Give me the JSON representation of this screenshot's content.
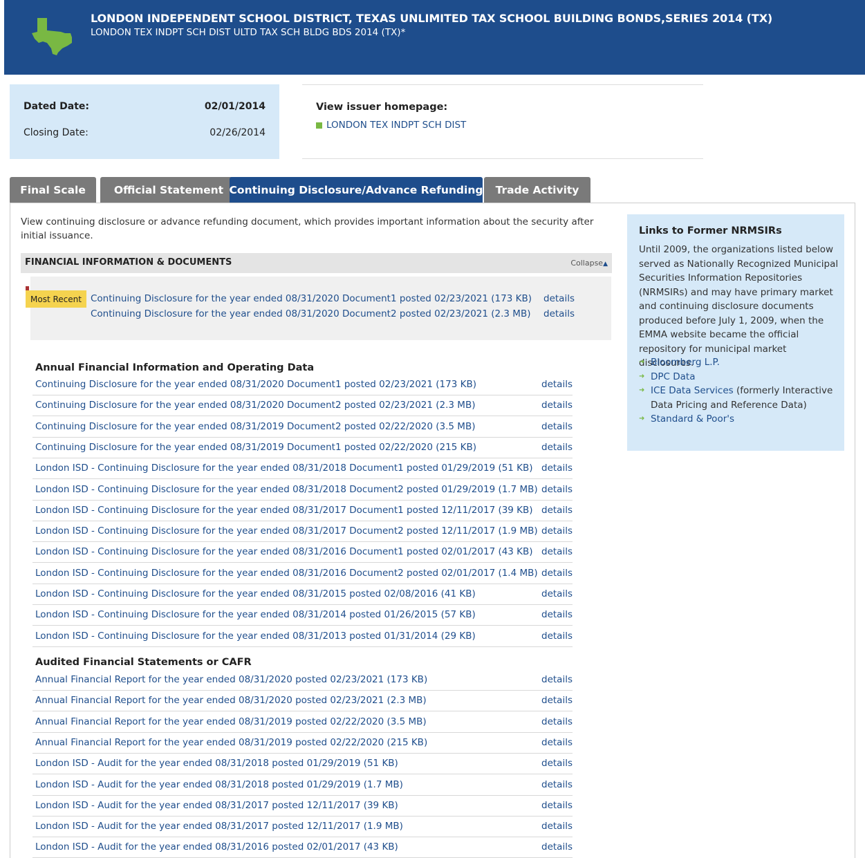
{
  "header": {
    "title": "LONDON INDEPENDENT SCHOOL DISTRICT, TEXAS UNLIMITED TAX SCHOOL BUILDING BONDS,SERIES 2014 (TX)",
    "subtitle": "LONDON TEX INDPT SCH DIST ULTD TAX SCH BLDG BDS 2014 (TX)*",
    "logo_icon": "texas-state-icon",
    "logo_color": "#79b843",
    "background": "#1e4d8c"
  },
  "dates": {
    "dated_label": "Dated Date:",
    "dated_value": "02/01/2014",
    "closing_label": "Closing Date:",
    "closing_value": "02/26/2014"
  },
  "issuer": {
    "label": "View issuer homepage:",
    "link": "LONDON TEX INDPT SCH DIST"
  },
  "tabs": [
    {
      "label": "Final Scale",
      "active": false
    },
    {
      "label": "Official Statement",
      "active": false
    },
    {
      "label": "Continuing Disclosure/Advance Refunding",
      "active": true
    },
    {
      "label": "Trade Activity",
      "active": false
    }
  ],
  "intro": "View continuing disclosure or advance refunding document, which provides important information about the security after initial issuance.",
  "financial_section": {
    "title": "FINANCIAL INFORMATION & DOCUMENTS",
    "collapse_label": "Collapse",
    "most_recent_badge": "Most Recent",
    "recent": [
      {
        "text": "Continuing Disclosure for the year ended 08/31/2020 Document1 posted 02/23/2021 (173 KB)",
        "details": "details"
      },
      {
        "text": "Continuing Disclosure for the year ended 08/31/2020 Document2 posted 02/23/2021 (2.3 MB)",
        "details": "details"
      }
    ]
  },
  "annual_section": {
    "title": "Annual Financial Information and Operating Data",
    "rows": [
      {
        "text": "Continuing Disclosure for the year ended 08/31/2020 Document1 posted 02/23/2021 (173 KB)",
        "details": "details"
      },
      {
        "text": "Continuing Disclosure for the year ended 08/31/2020 Document2 posted 02/23/2021 (2.3 MB)",
        "details": "details"
      },
      {
        "text": "Continuing Disclosure for the year ended 08/31/2019 Document2 posted 02/22/2020 (3.5 MB)",
        "details": "details"
      },
      {
        "text": "Continuing Disclosure for the year ended 08/31/2019 Document1 posted 02/22/2020 (215 KB)",
        "details": "details"
      },
      {
        "text": "London ISD - Continuing Disclosure for the year ended 08/31/2018 Document1 posted 01/29/2019 (51 KB)",
        "details": "details"
      },
      {
        "text": "London ISD - Continuing Disclosure for the year ended 08/31/2018 Document2 posted 01/29/2019 (1.7 MB)",
        "details": "details"
      },
      {
        "text": "London ISD - Continuing Disclosure for the year ended 08/31/2017 Document1 posted 12/11/2017 (39 KB)",
        "details": "details"
      },
      {
        "text": "London ISD - Continuing Disclosure for the year ended 08/31/2017 Document2 posted 12/11/2017 (1.9 MB)",
        "details": "details"
      },
      {
        "text": "London ISD - Continuing Disclosure for the year ended 08/31/2016 Document1 posted 02/01/2017 (43 KB)",
        "details": "details"
      },
      {
        "text": "London ISD - Continuing Disclosure for the year ended 08/31/2016 Document2 posted 02/01/2017 (1.4 MB)",
        "details": "details"
      },
      {
        "text": "London ISD - Continuing Disclosure for the year ended 08/31/2015 posted 02/08/2016 (41 KB)",
        "details": "details"
      },
      {
        "text": "London ISD - Continuing Disclosure for the year ended 08/31/2014 posted 01/26/2015 (57 KB)",
        "details": "details"
      },
      {
        "text": "London ISD - Continuing Disclosure for the year ended 08/31/2013 posted 01/31/2014 (29 KB)",
        "details": "details"
      }
    ]
  },
  "audited_section": {
    "title": "Audited Financial Statements or CAFR",
    "rows": [
      {
        "text": "Annual Financial Report for the year ended 08/31/2020 posted 02/23/2021 (173 KB)",
        "details": "details"
      },
      {
        "text": "Annual Financial Report for the year ended 08/31/2020 posted 02/23/2021 (2.3 MB)",
        "details": "details"
      },
      {
        "text": "Annual Financial Report for the year ended 08/31/2019 posted 02/22/2020 (3.5 MB)",
        "details": "details"
      },
      {
        "text": "Annual Financial Report for the year ended 08/31/2019 posted 02/22/2020 (215 KB)",
        "details": "details"
      },
      {
        "text": "London ISD - Audit for the year ended 08/31/2018 posted 01/29/2019 (51 KB)",
        "details": "details"
      },
      {
        "text": "London ISD - Audit for the year ended 08/31/2018 posted 01/29/2019 (1.7 MB)",
        "details": "details"
      },
      {
        "text": "London ISD - Audit for the year ended 08/31/2017 posted 12/11/2017 (39 KB)",
        "details": "details"
      },
      {
        "text": "London ISD - Audit for the year ended 08/31/2017 posted 12/11/2017 (1.9 MB)",
        "details": "details"
      },
      {
        "text": "London ISD - Audit for the year ended 08/31/2016 posted 02/01/2017 (43 KB)",
        "details": "details"
      }
    ]
  },
  "sidebar": {
    "title": "Links to Former NRMSIRs",
    "text": "Until 2009, the organizations listed below served as Nationally Recognized Municipal Securities Information Repositories (NRMSIRs) and may have primary market and continuing disclosure documents produced before July 1, 2009, when the EMMA website became the official repository for municipal market disclosures.",
    "links": [
      {
        "link": "Bloomberg L.P.",
        "suffix": ""
      },
      {
        "link": "DPC Data",
        "suffix": ""
      },
      {
        "link": "ICE Data Services",
        "suffix": " (formerly Interactive Data Pricing and Reference Data)"
      },
      {
        "link": "Standard & Poor's",
        "suffix": ""
      }
    ]
  }
}
